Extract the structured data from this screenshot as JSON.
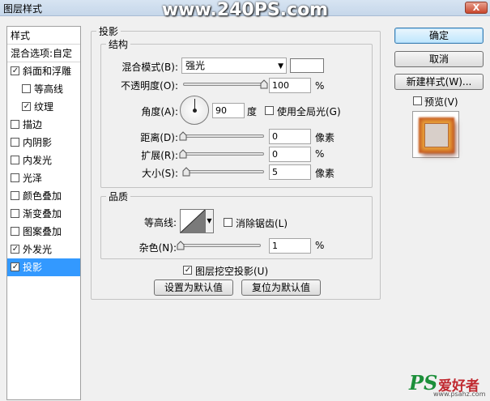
{
  "window": {
    "title": "图层样式",
    "watermark": "www.240PS.com",
    "close_label": "X"
  },
  "sidebar": {
    "items": [
      {
        "label": "样式",
        "type": "header",
        "checked": null
      },
      {
        "label": "混合选项:自定",
        "type": "header",
        "checked": null
      },
      {
        "label": "斜面和浮雕",
        "type": "item",
        "checked": true
      },
      {
        "label": "等高线",
        "type": "sub",
        "checked": false
      },
      {
        "label": "纹理",
        "type": "sub",
        "checked": true
      },
      {
        "label": "描边",
        "type": "item",
        "checked": false
      },
      {
        "label": "内阴影",
        "type": "item",
        "checked": false
      },
      {
        "label": "内发光",
        "type": "item",
        "checked": false
      },
      {
        "label": "光泽",
        "type": "item",
        "checked": false
      },
      {
        "label": "颜色叠加",
        "type": "item",
        "checked": false
      },
      {
        "label": "渐变叠加",
        "type": "item",
        "checked": false
      },
      {
        "label": "图案叠加",
        "type": "item",
        "checked": false
      },
      {
        "label": "外发光",
        "type": "item",
        "checked": true
      },
      {
        "label": "投影",
        "type": "item",
        "checked": true,
        "selected": true
      }
    ]
  },
  "panel": {
    "title": "投影",
    "structure": {
      "title": "结构",
      "blend_mode_label": "混合模式(B):",
      "blend_mode_value": "强光",
      "opacity_label": "不透明度(O):",
      "opacity_value": "100",
      "opacity_unit": "%",
      "opacity_level": 1.0,
      "angle_label": "角度(A):",
      "angle_value": "90",
      "angle_unit": "度",
      "global_light_label": "使用全局光(G)",
      "global_light_checked": false,
      "distance_label": "距离(D):",
      "distance_value": "0",
      "distance_unit": "像素",
      "distance_level": 0.0,
      "spread_label": "扩展(R):",
      "spread_value": "0",
      "spread_unit": "%",
      "spread_level": 0.0,
      "size_label": "大小(S):",
      "size_value": "5",
      "size_unit": "像素",
      "size_level": 0.04
    },
    "quality": {
      "title": "品质",
      "contour_label": "等高线:",
      "anti_alias_label": "消除锯齿(L)",
      "anti_alias_checked": false,
      "noise_label": "杂色(N):",
      "noise_value": "1",
      "noise_unit": "%",
      "noise_level": 0.01
    },
    "knockout_label": "图层挖空投影(U)",
    "knockout_checked": true,
    "make_default_label": "设置为默认值",
    "reset_default_label": "复位为默认值"
  },
  "actions": {
    "ok_label": "确定",
    "cancel_label": "取消",
    "new_style_label": "新建样式(W)...",
    "preview_label": "预览(V)",
    "preview_checked": false
  },
  "footer_logo": {
    "ps": "PS",
    "name": "爱好者",
    "url": "www.psahz.com"
  }
}
